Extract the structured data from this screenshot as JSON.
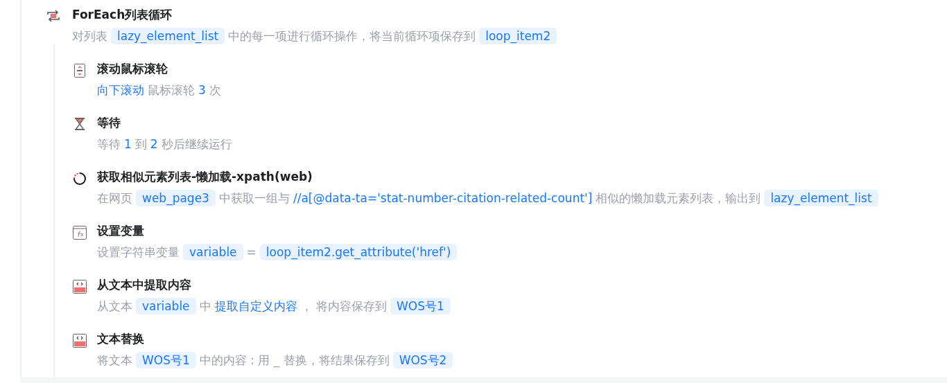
{
  "loop": {
    "kind": "loop",
    "title": "ForEach列表循环",
    "description": [
      {
        "kind": "text",
        "text": "对列表"
      },
      {
        "kind": "tag",
        "text": "lazy_element_list"
      },
      {
        "kind": "text",
        "text": "中的每一项进行循环操作，将当前循环项保存到"
      },
      {
        "kind": "tag",
        "text": "loop_item2"
      }
    ],
    "steps": [
      {
        "kind": "scroll",
        "title": "滚动鼠标滚轮",
        "description": [
          {
            "kind": "link",
            "text": "向下滚动"
          },
          {
            "kind": "text",
            "text": "鼠标滚轮"
          },
          {
            "kind": "link",
            "text": "3"
          },
          {
            "kind": "text",
            "text": "次"
          }
        ]
      },
      {
        "kind": "hourglass",
        "title": "等待",
        "description": [
          {
            "kind": "text",
            "text": "等待"
          },
          {
            "kind": "link",
            "text": "1"
          },
          {
            "kind": "text",
            "text": "到"
          },
          {
            "kind": "link",
            "text": "2"
          },
          {
            "kind": "text",
            "text": "秒后继续运行"
          }
        ]
      },
      {
        "kind": "spinner",
        "title": "获取相似元素列表-懒加载-xpath(web)",
        "description": [
          {
            "kind": "text",
            "text": "在网页"
          },
          {
            "kind": "tag",
            "text": "web_page3"
          },
          {
            "kind": "text",
            "text": "中获取一组与"
          },
          {
            "kind": "link",
            "text": "//a[@data-ta='stat-number-citation-related-count']"
          },
          {
            "kind": "text",
            "text": "相似的懒加载元素列表，输出到"
          },
          {
            "kind": "tag",
            "text": "lazy_element_list"
          }
        ]
      },
      {
        "kind": "function",
        "title": "设置变量",
        "description": [
          {
            "kind": "text",
            "text": "设置字符串变量"
          },
          {
            "kind": "tag",
            "text": "variable"
          },
          {
            "kind": "text",
            "text": "="
          },
          {
            "kind": "tag",
            "text": "loop_item2.get_attribute('href')"
          }
        ]
      },
      {
        "kind": "text",
        "title": "从文本中提取内容",
        "description": [
          {
            "kind": "text",
            "text": "从文本"
          },
          {
            "kind": "tag",
            "text": "variable"
          },
          {
            "kind": "text",
            "text": "中"
          },
          {
            "kind": "link",
            "text": "提取自定义内容"
          },
          {
            "kind": "text",
            "text": "， 将内容保存到"
          },
          {
            "kind": "tag",
            "text": "WOS号1"
          }
        ]
      },
      {
        "kind": "text",
        "title": "文本替换",
        "description": [
          {
            "kind": "text",
            "text": "将文本"
          },
          {
            "kind": "tag",
            "text": "WOS号1"
          },
          {
            "kind": "text",
            "text": "中的内容 : 用 _ 替换，将结果保存到"
          },
          {
            "kind": "tag",
            "text": "WOS号2"
          }
        ]
      }
    ]
  }
}
